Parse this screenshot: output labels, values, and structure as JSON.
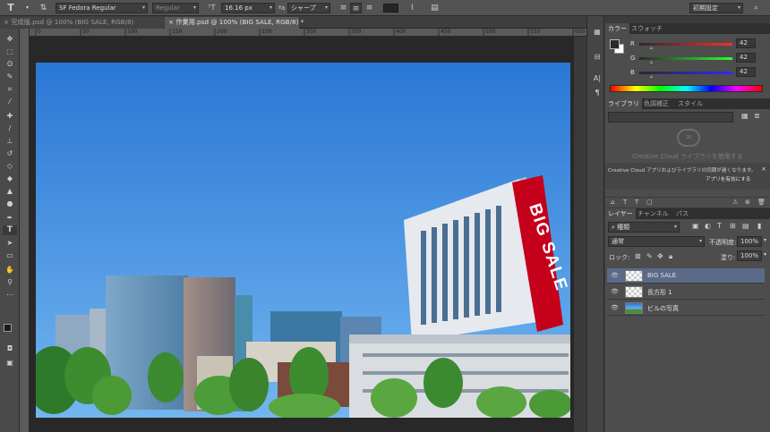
{
  "options_bar": {
    "text_tool_icon": "T",
    "font_family": "SF Fedora Regular",
    "font_style": "Regular",
    "font_size": "16.16 px",
    "antialias": "シャープ",
    "workspace": "初期設定",
    "icons": [
      "text-orientation-icon",
      "font-size-icon",
      "align-left-icon",
      "align-center-icon",
      "align-right-icon",
      "text-color-swatch",
      "warp-text-icon",
      "character-panel-icon",
      "search-icon",
      "workspace-icon"
    ]
  },
  "tabs": [
    {
      "label": "完成版.psd @ 100% (BIG SALE, RGB/8)",
      "close": "×",
      "active": false
    },
    {
      "label": "作業用.psd @ 100% (BIG SALE, RGB/8) *",
      "close": "×",
      "active": true
    }
  ],
  "ruler_labels": [
    "0",
    "50",
    "100",
    "150",
    "200",
    "250",
    "300",
    "350",
    "400",
    "450",
    "500",
    "550",
    "600"
  ],
  "billboard_text": "BIG SALE",
  "color_panel": {
    "tabs": [
      "カラー",
      "スウォッチ"
    ],
    "channels": [
      {
        "name": "R",
        "value": "42"
      },
      {
        "name": "G",
        "value": "42"
      },
      {
        "name": "B",
        "value": "42"
      }
    ],
    "foreground": "#2a2a2a",
    "background": "#ffffff"
  },
  "library_panel": {
    "tabs": [
      "ライブラリ",
      "色調補正",
      "スタイル"
    ],
    "cc_title": "Creative Cloud ライブラリを使用する",
    "message": "Creative Cloud アプリおよびライブラリの同期が遅くなります。",
    "link": "アプリを有効にする",
    "close": "×"
  },
  "layers_panel": {
    "tabs": [
      "レイヤー",
      "チャンネル",
      "パス"
    ],
    "filter_kind": "種類",
    "blend_mode": "通常",
    "opacity_label": "不透明度:",
    "opacity": "100%",
    "lock_label": "ロック:",
    "fill_label": "塗り:",
    "fill": "100%",
    "layers": [
      {
        "name": "BIG SALE",
        "selected": true
      },
      {
        "name": "長方形 1",
        "selected": false
      },
      {
        "name": "ビルの写真",
        "selected": false
      }
    ]
  },
  "colors": {
    "sky_top": "#2b78d6",
    "sky_bottom": "#6fb3ef",
    "billboard_red": "#c5001a",
    "selection_blue": "#5a6a88"
  }
}
